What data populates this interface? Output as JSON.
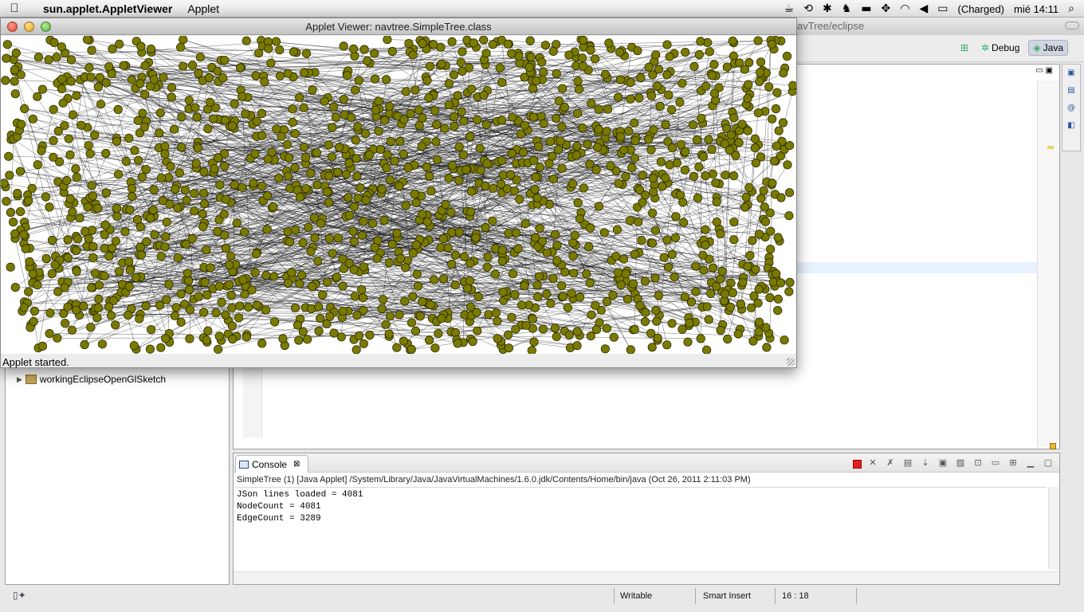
{
  "menubar": {
    "app_name": "sun.applet.AppletViewer",
    "menu_applet": "Applet",
    "battery": "(Charged)",
    "datetime": "mié 14:11"
  },
  "eclipse": {
    "title_path": "avTree/eclipse",
    "perspectives": {
      "debug": "Debug",
      "java": "Java"
    },
    "project_tree": {
      "item": "workingEclipseOpenGlSketch"
    }
  },
  "applet": {
    "title": "Applet Viewer: navtree.SimpleTree.class",
    "status": "Applet started.",
    "node_color": "#7a7a00"
  },
  "console": {
    "tab_label": "Console",
    "header": "SimpleTree (1) [Java Applet] /System/Library/Java/JavaVirtualMachines/1.6.0.jdk/Contents/Home/bin/java (Oct 26, 2011 2:11:03 PM)",
    "lines": [
      "JSon lines loaded = 4081",
      "NodeCount = 4081",
      "EdgeCount = 3289"
    ]
  },
  "statusbar": {
    "writable": "Writable",
    "insert_mode": "Smart Insert",
    "position": "16 : 18"
  }
}
